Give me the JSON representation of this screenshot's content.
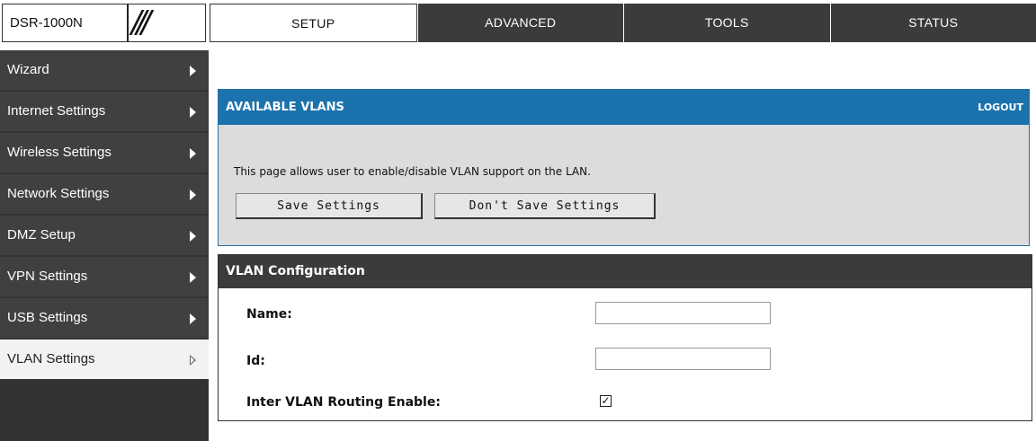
{
  "header": {
    "model": "DSR-1000N",
    "tabs": [
      "SETUP",
      "ADVANCED",
      "TOOLS",
      "STATUS"
    ],
    "active_tab": "SETUP"
  },
  "sidebar": {
    "items": [
      {
        "label": "Wizard"
      },
      {
        "label": "Internet Settings"
      },
      {
        "label": "Wireless Settings"
      },
      {
        "label": "Network Settings"
      },
      {
        "label": "DMZ Setup"
      },
      {
        "label": "VPN Settings"
      },
      {
        "label": "USB Settings"
      },
      {
        "label": "VLAN Settings"
      }
    ],
    "active_item": "VLAN Settings"
  },
  "available_vlans": {
    "title": "AVAILABLE VLANS",
    "logout_label": "LOGOUT",
    "description": "This page allows user to enable/disable VLAN support on the LAN.",
    "save_label": "Save Settings",
    "dont_save_label": "Don't Save Settings"
  },
  "vlan_config": {
    "title": "VLAN Configuration",
    "name_label": "Name:",
    "name_value": "",
    "id_label": "Id:",
    "id_value": "",
    "inter_vlan_label": "Inter VLAN Routing Enable:",
    "inter_vlan_checked": true,
    "check_mark": "✓"
  },
  "colors": {
    "header_blue": "#1b72ad",
    "dark": "#3b3b3b",
    "panel_bg": "#dcdcdc"
  }
}
